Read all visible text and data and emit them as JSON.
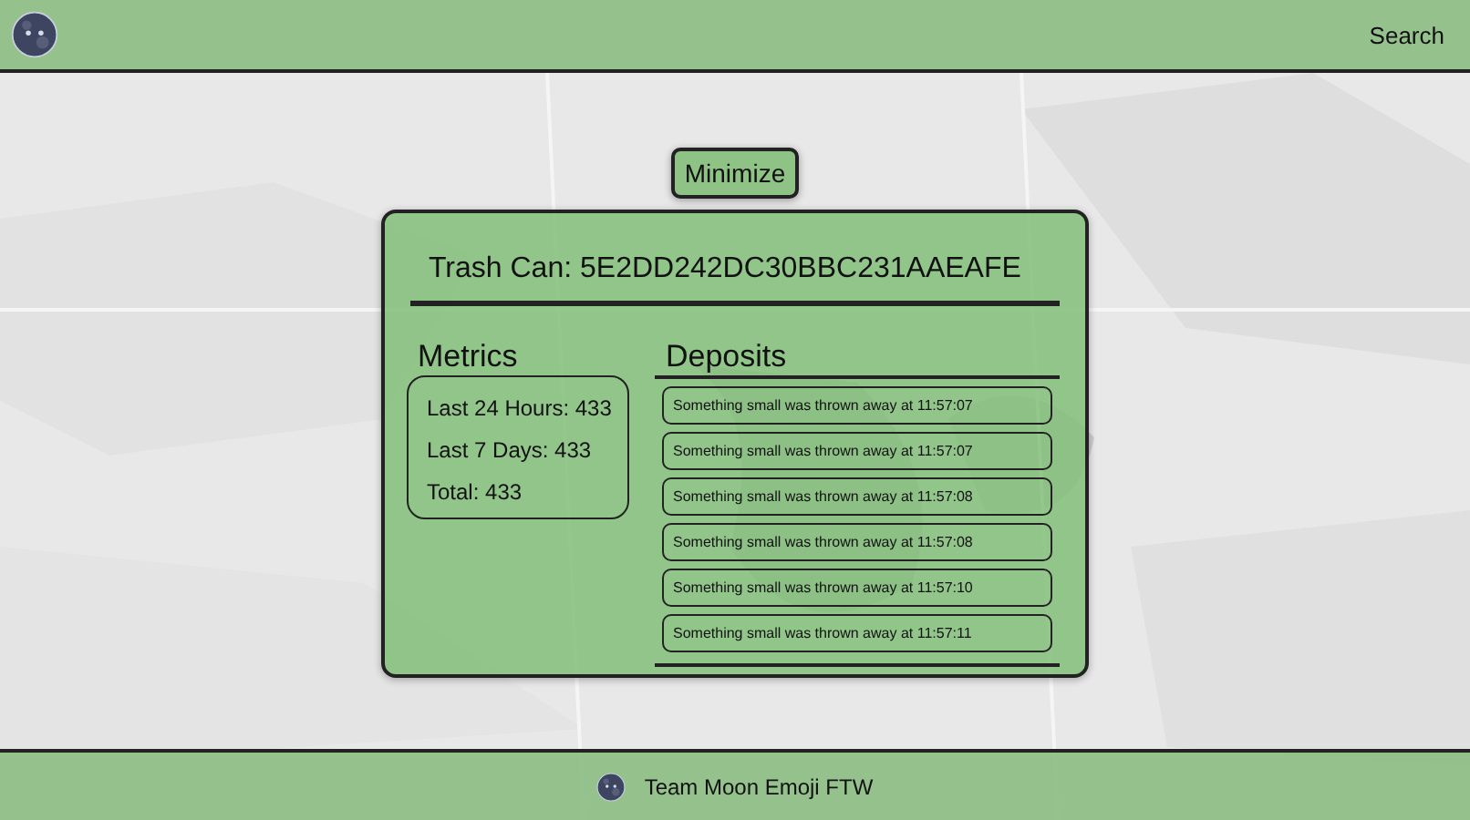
{
  "header": {
    "search_link": "Search"
  },
  "minimize_button": "Minimize",
  "panel": {
    "title": "Trash Can: 5E2DD242DC30BBC231AAEAFE",
    "metrics": {
      "heading": "Metrics",
      "items": [
        "Last 24 Hours: 433",
        "Last 7 Days: 433",
        "Total: 433"
      ]
    },
    "deposits": {
      "heading": "Deposits",
      "items": [
        "Something small was thrown away at 11:57:07",
        "Something small was thrown away at 11:57:07",
        "Something small was thrown away at 11:57:08",
        "Something small was thrown away at 11:57:08",
        "Something small was thrown away at 11:57:10",
        "Something small was thrown away at 11:57:11"
      ]
    }
  },
  "footer": {
    "team_name": "Team Moon Emoji FTW"
  }
}
